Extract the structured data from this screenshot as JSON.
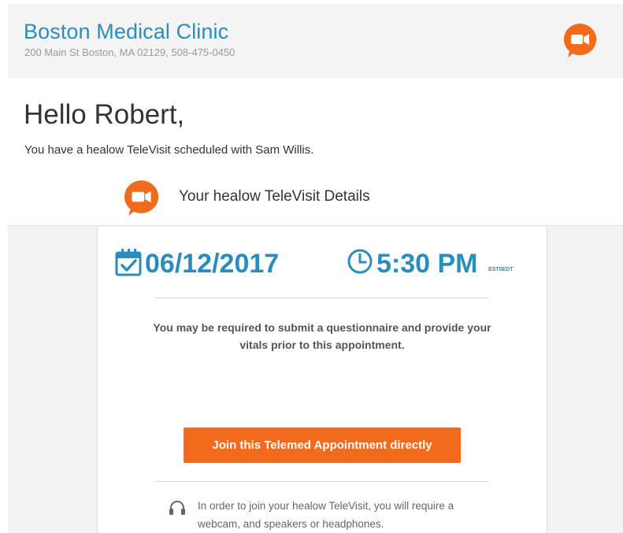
{
  "header": {
    "clinic_name": "Boston Medical Clinic",
    "clinic_address": "200 Main St Boston, MA 02129, 508-475-0450",
    "icon": "video-chat-icon"
  },
  "greeting": {
    "title": "Hello Robert,",
    "subline": "You have a healow TeleVisit scheduled with Sam Willis."
  },
  "details": {
    "title": "Your healow TeleVisit Details",
    "icon": "video-chat-icon"
  },
  "appointment": {
    "date": "06/12/2017",
    "time": "5:30 PM",
    "timezone": "EST5EDT",
    "notice": "You may be required to submit a questionnaire and provide your vitals prior to this appointment.",
    "join_label": "Join this Telemed Appointment directly",
    "requirement": "In order to join your healow TeleVisit, you will require a webcam, and speakers or headphones."
  },
  "colors": {
    "brand_blue": "#2b8dbd",
    "accent_orange": "#f26a1b",
    "header_bg": "#f4f4f4"
  }
}
